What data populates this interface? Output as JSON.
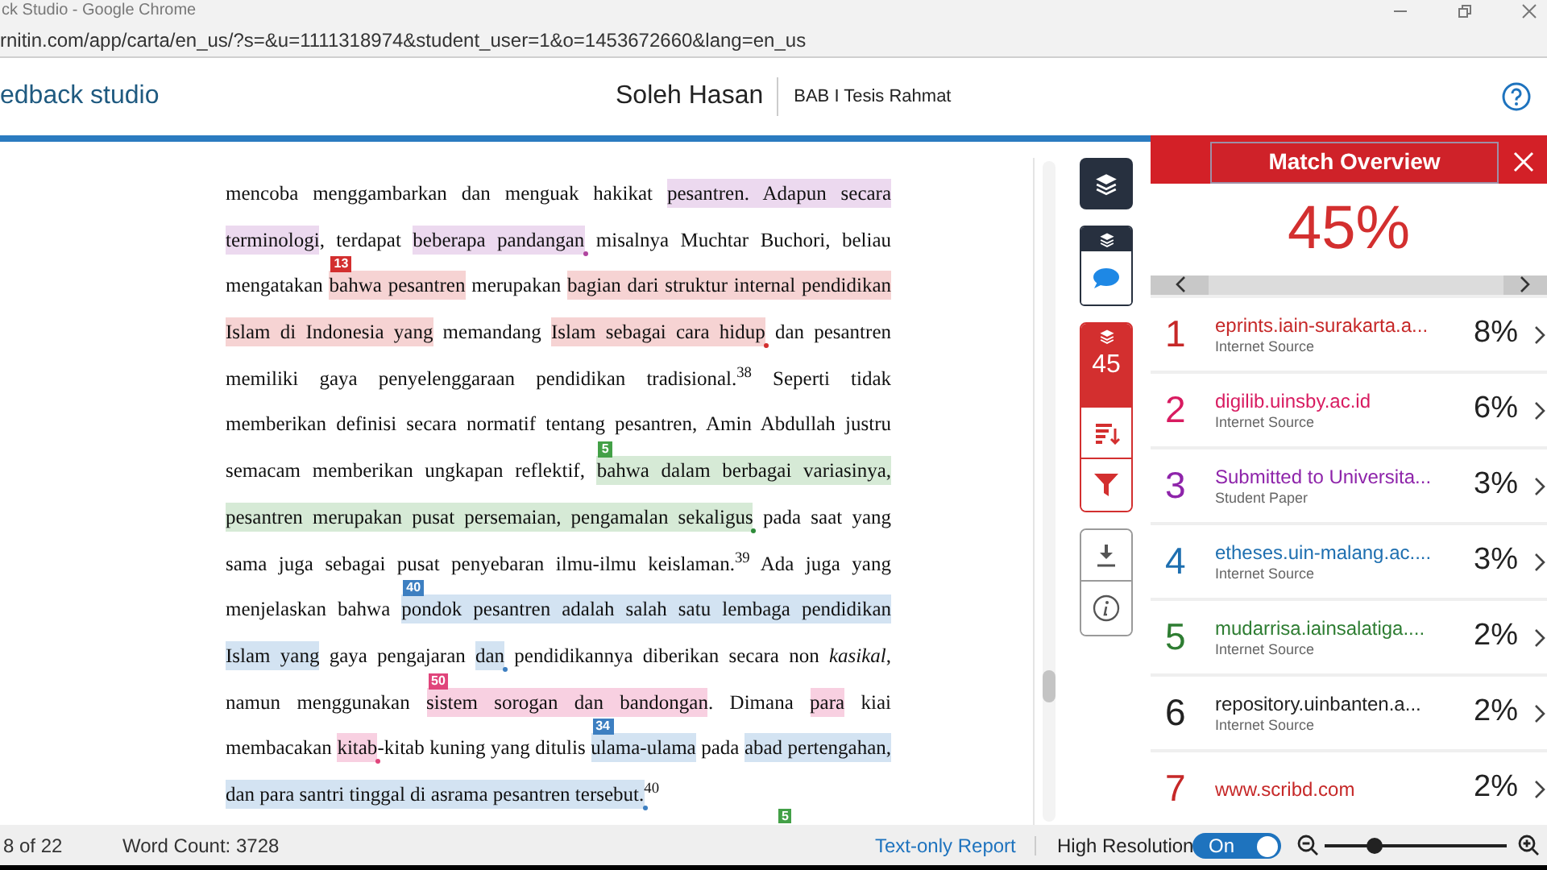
{
  "browser": {
    "title": "ck Studio - Google Chrome",
    "url": "rnitin.com/app/carta/en_us/?s=&u=1111318974&student_user=1&o=1453672660&lang=en_us"
  },
  "header": {
    "brand": "edback studio",
    "student": "Soleh Hasan",
    "paper": "BAB I Tesis Rahmat"
  },
  "document": {
    "lines": [
      {
        "justify": true,
        "segments": [
          {
            "text": "mencoba menggambarkan dan menguak hakikat "
          },
          {
            "text": "pesantren. Adapun secara",
            "color": "#ecd9ef"
          }
        ]
      },
      {
        "justify": true,
        "segments": [
          {
            "text": "terminologi",
            "color": "#ecd9ef"
          },
          {
            "text": ", terdapat "
          },
          {
            "text": "beberapa pandangan",
            "color": "#ecd9ef",
            "dot": true
          },
          {
            "text": " misalnya Muchtar Buchori, beliau"
          }
        ]
      },
      {
        "justify": true,
        "segments": [
          {
            "text": "mengatakan "
          },
          {
            "text": "bahwa pesantren",
            "color": "#f6d3d3",
            "marker": {
              "label": "13",
              "color": "#d32f2f"
            }
          },
          {
            "text": " merupakan "
          },
          {
            "text": "bagian dari struktur internal pendidikan",
            "color": "#f6d3d3"
          }
        ]
      },
      {
        "justify": true,
        "segments": [
          {
            "text": "Islam di Indonesia yang",
            "color": "#f6d3d3"
          },
          {
            "text": " memandang "
          },
          {
            "text": "Islam sebagai cara hidup",
            "color": "#f6d3d3",
            "dot": true
          },
          {
            "text": " dan pesantren"
          }
        ]
      },
      {
        "justify": true,
        "segments": [
          {
            "text": "memiliki gaya penyelenggaraan pendidikan tradisional.$^{38}$ Seperti tidak"
          }
        ]
      },
      {
        "justify": true,
        "segments": [
          {
            "text": "memberikan definisi secara normatif tentang pesantren, Amin Abdullah justru"
          }
        ]
      },
      {
        "justify": true,
        "segments": [
          {
            "text": "semacam memberikan ungkapan reflektif, "
          },
          {
            "text": "bahwa dalam berbagai variasinya,",
            "color": "#d6ead6",
            "marker": {
              "label": "5",
              "color": "#43a047"
            }
          }
        ]
      },
      {
        "justify": true,
        "segments": [
          {
            "text": "pesantren merupakan pusat persemaian, pengamalan sekaligus",
            "color": "#d6ead6",
            "dot": true
          },
          {
            "text": " pada saat yang"
          }
        ]
      },
      {
        "justify": true,
        "segments": [
          {
            "text": "sama juga sebagai pusat penyebaran ilmu-ilmu keislaman.$^{39}$ Ada juga yang"
          }
        ]
      },
      {
        "justify": true,
        "segments": [
          {
            "text": "menjelaskan bahwa "
          },
          {
            "text": "pondok pesantren adalah salah satu lembaga pendidikan",
            "color": "#d3e3f2",
            "marker": {
              "label": "40",
              "color": "#3d7fc1"
            }
          }
        ]
      },
      {
        "justify": true,
        "segments": [
          {
            "text": "Islam yang",
            "color": "#d3e3f2"
          },
          {
            "text": " gaya pengajaran "
          },
          {
            "text": "dan",
            "color": "#d3e3f2",
            "dot": true
          },
          {
            "text": " pendidikannya diberikan secara non *kasikal*,"
          }
        ]
      },
      {
        "justify": true,
        "segments": [
          {
            "text": "namun menggunakan "
          },
          {
            "text": "sistem sorogan dan bandongan",
            "color": "#f8d0e1",
            "marker": {
              "label": "50",
              "color": "#e0457b"
            }
          },
          {
            "text": ". Dimana "
          },
          {
            "text": "para",
            "color": "#f8d0e1"
          },
          {
            "text": " kiai"
          }
        ]
      },
      {
        "justify": true,
        "segments": [
          {
            "text": "membacakan "
          },
          {
            "text": "kitab",
            "color": "#f8d0e1",
            "dot": true
          },
          {
            "text": "-kitab kuning yang ditulis "
          },
          {
            "text": "ulama-ulama",
            "color": "#d3e3f2",
            "marker": {
              "label": "34",
              "color": "#3d7fc1"
            }
          },
          {
            "text": " pada "
          },
          {
            "text": "abad pertengahan,",
            "color": "#d3e3f2"
          }
        ]
      },
      {
        "justify": false,
        "segments": [
          {
            "text": "dan para santri tinggal di asrama pesantren tersebut.",
            "color": "#d3e3f2",
            "dot": true
          },
          {
            "text": "$^{40}$"
          }
        ]
      }
    ],
    "trailing_marker": {
      "label": "5",
      "color": "#43a047"
    }
  },
  "toolbar": {
    "match_count": "45"
  },
  "match_panel": {
    "title": "Match Overview",
    "score": "45%",
    "sources": [
      {
        "rank": "1",
        "name": "eprints.iain-surakarta.a...",
        "type": "Internet Source",
        "percent": "8%",
        "color": "#c62828"
      },
      {
        "rank": "2",
        "name": "digilib.uinsby.ac.id",
        "type": "Internet Source",
        "percent": "6%",
        "color": "#d81b60"
      },
      {
        "rank": "3",
        "name": "Submitted to Universita...",
        "type": "Student Paper",
        "percent": "3%",
        "color": "#8e24aa"
      },
      {
        "rank": "4",
        "name": "etheses.uin-malang.ac....",
        "type": "Internet Source",
        "percent": "3%",
        "color": "#1e6fb0"
      },
      {
        "rank": "5",
        "name": "mudarrisa.iainsalatiga....",
        "type": "Internet Source",
        "percent": "2%",
        "color": "#2e7d32"
      },
      {
        "rank": "6",
        "name": "repository.uinbanten.a...",
        "type": "Internet Source",
        "percent": "2%",
        "color": "#222222"
      },
      {
        "rank": "7",
        "name": "www.scribd.com",
        "percent": "2%",
        "color": "#c62828"
      }
    ]
  },
  "status_bar": {
    "page": "8 of 22",
    "word_count": "Word Count: 3728",
    "report_link": "Text-only Report",
    "resolution_label": "High Resolution",
    "toggle": {
      "label": "On",
      "on": true
    },
    "zoom": {
      "level": 0.27
    }
  }
}
